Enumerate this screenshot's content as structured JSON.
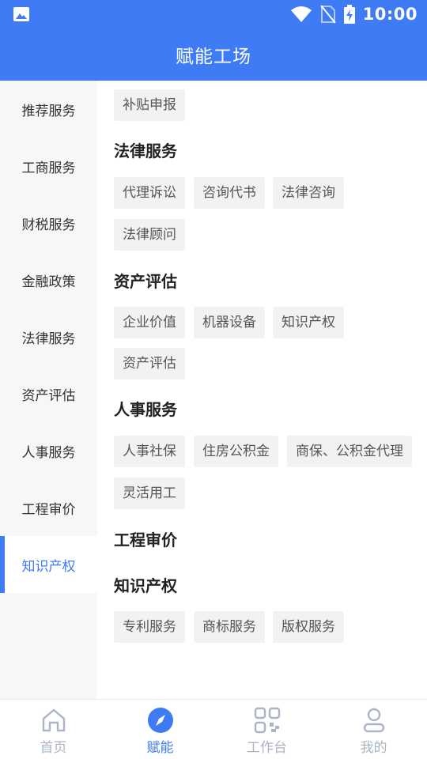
{
  "status_bar": {
    "time": "10:00",
    "icons": [
      "image-icon",
      "wifi-icon",
      "no-sim-icon",
      "battery-charging-icon"
    ]
  },
  "header": {
    "title": "赋能工场"
  },
  "sidebar": {
    "items": [
      {
        "label": "推荐服务"
      },
      {
        "label": "工商服务"
      },
      {
        "label": "财税服务"
      },
      {
        "label": "金融政策"
      },
      {
        "label": "法律服务"
      },
      {
        "label": "资产评估"
      },
      {
        "label": "人事服务"
      },
      {
        "label": "工程审价"
      },
      {
        "label": "知识产权"
      }
    ],
    "active_index": 8
  },
  "content": {
    "top_tags": [
      "补贴申报"
    ],
    "sections": [
      {
        "title": "法律服务",
        "tags": [
          "代理诉讼",
          "咨询代书",
          "法律咨询",
          "法律顾问"
        ]
      },
      {
        "title": "资产评估",
        "tags": [
          "企业价值",
          "机器设备",
          "知识产权",
          "资产评估"
        ]
      },
      {
        "title": "人事服务",
        "tags": [
          "人事社保",
          "住房公积金",
          "商保、公积金代理",
          "灵活用工"
        ]
      },
      {
        "title": "工程审价",
        "tags": []
      },
      {
        "title": "知识产权",
        "tags": [
          "专利服务",
          "商标服务",
          "版权服务"
        ]
      }
    ]
  },
  "bottom_nav": {
    "items": [
      {
        "label": "首页",
        "icon": "home-icon"
      },
      {
        "label": "赋能",
        "icon": "compass-icon"
      },
      {
        "label": "工作台",
        "icon": "qr-grid-icon"
      },
      {
        "label": "我的",
        "icon": "user-icon"
      }
    ],
    "active_index": 1
  },
  "colors": {
    "primary": "#3E7BF5",
    "sidebar_bg": "#F6F7F9",
    "tag_bg": "#F2F2F4",
    "nav_inactive": "#A9B4C6"
  }
}
